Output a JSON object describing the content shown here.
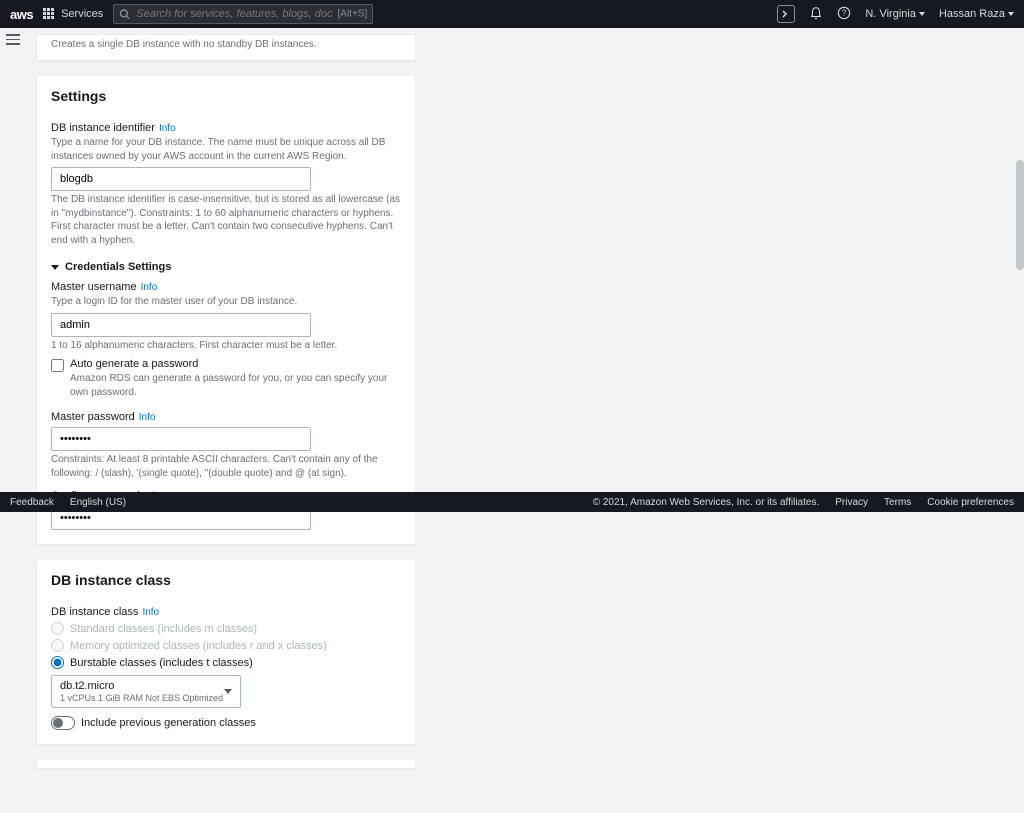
{
  "topnav": {
    "logo": "aws",
    "services": "Services",
    "search_placeholder": "Search for services, features, blogs, docs, and more",
    "search_shortcut": "[Alt+S]",
    "region": "N. Virginia",
    "user": "Hassan Raza"
  },
  "remnant_panel": {
    "desc": "Creates a single DB instance with no standby DB instances."
  },
  "settings": {
    "title": "Settings",
    "identifier": {
      "label": "DB instance identifier",
      "info": "Info",
      "help1": "Type a name for your DB instance. The name must be unique across all DB instances owned by your AWS account in the current AWS Region.",
      "value": "blogdb",
      "help2": "The DB instance identifier is case-insensitive, but is stored as all lowercase (as in \"mydbinstance\"). Constraints: 1 to 60 alphanumeric characters or hyphens. First character must be a letter. Can't contain two consecutive hyphens. Can't end with a hyphen."
    },
    "credentials_header": "Credentials Settings",
    "username": {
      "label": "Master username",
      "info": "Info",
      "help1": "Type a login ID for the master user of your DB instance.",
      "value": "admin",
      "help2": "1 to 16 alphanumeric characters. First character must be a letter."
    },
    "autogen": {
      "label": "Auto generate a password",
      "help": "Amazon RDS can generate a password for you, or you can specify your own password."
    },
    "password": {
      "label": "Master password",
      "info": "Info",
      "value": "••••••••",
      "help": "Constraints: At least 8 printable ASCII characters. Can't contain any of the following: / (slash), '(single quote), \"(double quote) and @ (at sign)."
    },
    "confirm": {
      "label": "Confirm password",
      "info": "Info",
      "value": "••••••••"
    }
  },
  "instance_class": {
    "title": "DB instance class",
    "label": "DB instance class",
    "info": "Info",
    "options": {
      "standard": "Standard classes (includes m classes)",
      "memory": "Memory optimized classes (includes r and x classes)",
      "burstable": "Burstable classes (includes t classes)"
    },
    "select": {
      "value": "db.t2.micro",
      "sub": "1 vCPUs    1 GiB RAM    Not EBS Optimized"
    },
    "toggle_label": "Include previous generation classes"
  },
  "footer": {
    "feedback": "Feedback",
    "language": "English (US)",
    "copyright": "© 2021, Amazon Web Services, Inc. or its affiliates.",
    "privacy": "Privacy",
    "terms": "Terms",
    "cookies": "Cookie preferences"
  }
}
